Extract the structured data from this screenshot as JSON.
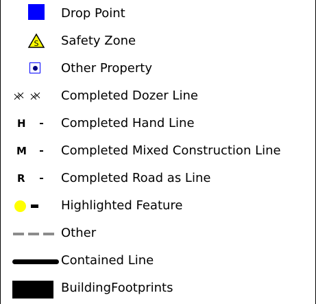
{
  "legend": {
    "items": [
      {
        "label": "Drop Point",
        "icon": "drop-point-square",
        "color": "#0000ff"
      },
      {
        "label": "Safety Zone",
        "icon": "safety-zone-triangle",
        "color": "#ffff00",
        "mark": "S"
      },
      {
        "label": "Other Property",
        "icon": "other-property-dot",
        "color": "#000080"
      },
      {
        "label": "Completed Dozer Line",
        "icon": "dozer-line-hatch",
        "color": "#000000"
      },
      {
        "label": "Completed Hand Line",
        "icon": "hand-line",
        "mark": "H"
      },
      {
        "label": "Completed Mixed Construction Line",
        "icon": "mixed-line",
        "mark": "M"
      },
      {
        "label": "Completed Road as Line",
        "icon": "road-line",
        "mark": "R"
      },
      {
        "label": "Highlighted Feature",
        "icon": "highlight-dot",
        "color": "#ffff00"
      },
      {
        "label": "Other",
        "icon": "dashed-line",
        "color": "#8c8c8c"
      },
      {
        "label": "Contained Line",
        "icon": "thick-line",
        "color": "#000000"
      },
      {
        "label": "BuildingFootprints",
        "icon": "black-rectangle",
        "color": "#000000"
      }
    ]
  }
}
